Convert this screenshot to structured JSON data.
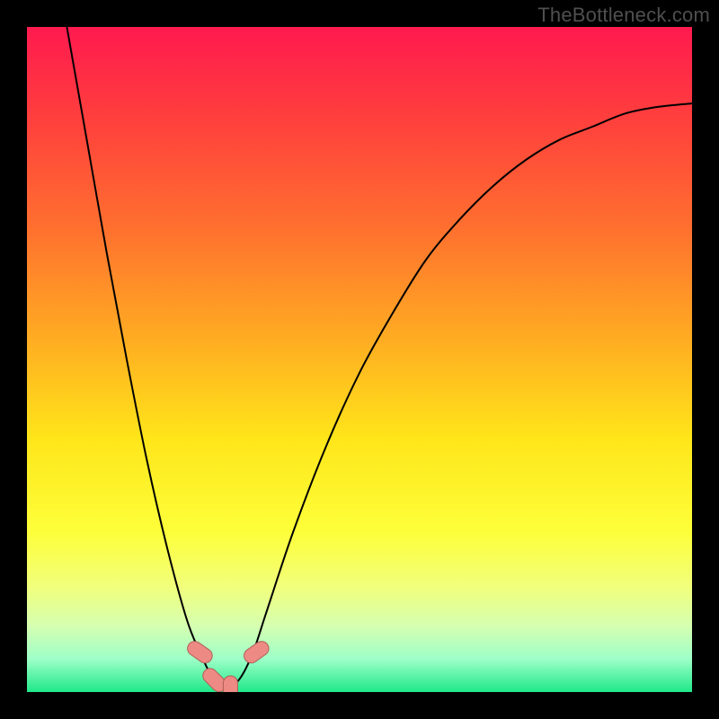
{
  "watermark": "TheBottleneck.com",
  "colors": {
    "frame_bg": "#000000",
    "curve_stroke": "#000000",
    "marker_fill": "#ed8a83",
    "marker_stroke": "#b15f59",
    "gradient_stops": [
      {
        "offset": 0.0,
        "color": "#ff1a4f"
      },
      {
        "offset": 0.12,
        "color": "#ff3a3f"
      },
      {
        "offset": 0.3,
        "color": "#ff6f2f"
      },
      {
        "offset": 0.48,
        "color": "#ffb021"
      },
      {
        "offset": 0.62,
        "color": "#ffe61a"
      },
      {
        "offset": 0.76,
        "color": "#fdff3a"
      },
      {
        "offset": 0.84,
        "color": "#f2ff7a"
      },
      {
        "offset": 0.9,
        "color": "#d6ffb0"
      },
      {
        "offset": 0.95,
        "color": "#9effc8"
      },
      {
        "offset": 1.0,
        "color": "#1fe88a"
      }
    ]
  },
  "chart_data": {
    "type": "line",
    "title": "",
    "xlabel": "",
    "ylabel": "",
    "xlim": [
      0,
      1
    ],
    "ylim": [
      0,
      1
    ],
    "series": [
      {
        "name": "bottleneck-curve",
        "x": [
          0.06,
          0.09,
          0.12,
          0.15,
          0.18,
          0.21,
          0.24,
          0.26,
          0.28,
          0.3,
          0.32,
          0.34,
          0.36,
          0.4,
          0.45,
          0.5,
          0.55,
          0.6,
          0.65,
          0.7,
          0.75,
          0.8,
          0.85,
          0.9,
          0.95,
          1.0
        ],
        "y": [
          1.0,
          0.83,
          0.66,
          0.5,
          0.35,
          0.22,
          0.11,
          0.06,
          0.02,
          0.005,
          0.02,
          0.06,
          0.12,
          0.24,
          0.37,
          0.48,
          0.57,
          0.65,
          0.71,
          0.76,
          0.8,
          0.83,
          0.85,
          0.87,
          0.88,
          0.885
        ]
      }
    ],
    "markers": [
      {
        "x": 0.26,
        "y": 0.06,
        "angle": -55
      },
      {
        "x": 0.282,
        "y": 0.018,
        "angle": -45
      },
      {
        "x": 0.306,
        "y": 0.004,
        "angle": 0
      },
      {
        "x": 0.345,
        "y": 0.06,
        "angle": 55
      }
    ]
  }
}
